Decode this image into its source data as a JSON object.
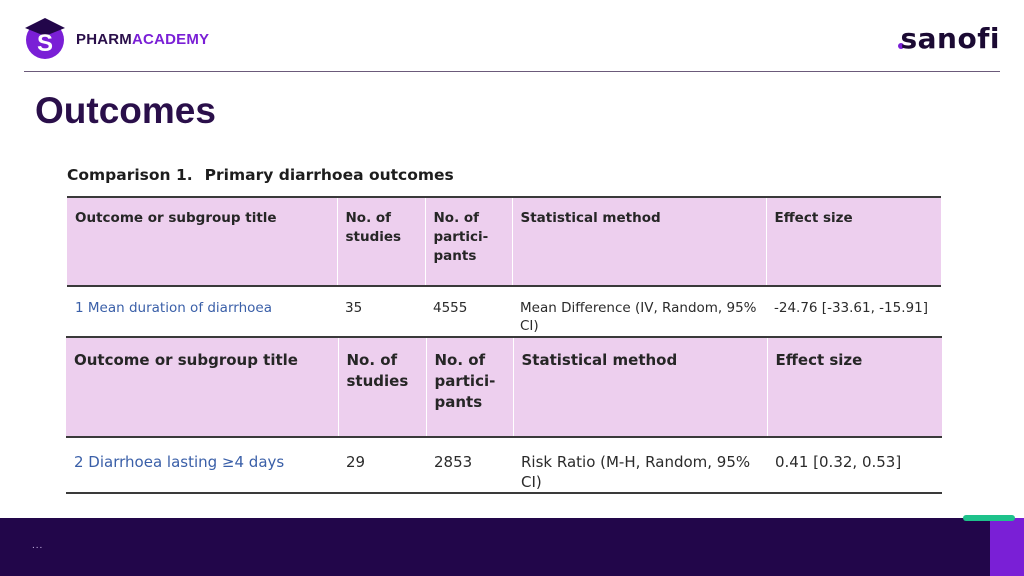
{
  "brand": {
    "logo_letter": "S",
    "name_part1": "PHARM",
    "name_part2": "ACADEMY",
    "partner": "sanofi"
  },
  "slide": {
    "title": "Outcomes"
  },
  "comparison": {
    "label": "Comparison 1.",
    "title": "Primary diarrhoea outcomes"
  },
  "columns": [
    "Outcome or subgroup title",
    "No. of studies",
    "No. of partici-pants",
    "Statistical method",
    "Effect size"
  ],
  "table1": {
    "headers": {
      "outcome": "Outcome or subgroup title",
      "studies_l1": "No. of",
      "studies_l2": "studies",
      "part_l1": "No. of",
      "part_l2": "partici-",
      "part_l3": "pants",
      "method": "Statistical method",
      "effect": "Effect size"
    },
    "row": {
      "outcome": "1 Mean duration of diarrhoea",
      "studies": "35",
      "participants": "4555",
      "method_l1": "Mean Difference (IV, Random, 95%",
      "method_l2": "CI)",
      "effect": "-24.76 [-33.61, -15.91]"
    }
  },
  "table2": {
    "headers": {
      "outcome": "Outcome or subgroup title",
      "studies_l1": "No. of",
      "studies_l2": "studies",
      "part_l1": "No. of",
      "part_l2": "partici-",
      "part_l3": "pants",
      "method": "Statistical method",
      "effect": "Effect size"
    },
    "row": {
      "outcome": "2 Diarrhoea lasting ≥4 days",
      "studies": "29",
      "participants": "2853",
      "method": "Risk Ratio (M-H, Random, 95% CI)",
      "effect": "0.41 [0.32, 0.53]"
    }
  },
  "footer": {
    "dots": "..."
  },
  "colors": {
    "brand_dark": "#22064a",
    "brand_purple": "#7a1fd6",
    "header_fill": "#edcfee",
    "link_blue": "#3a5fa8",
    "accent_green": "#1ec28b"
  }
}
